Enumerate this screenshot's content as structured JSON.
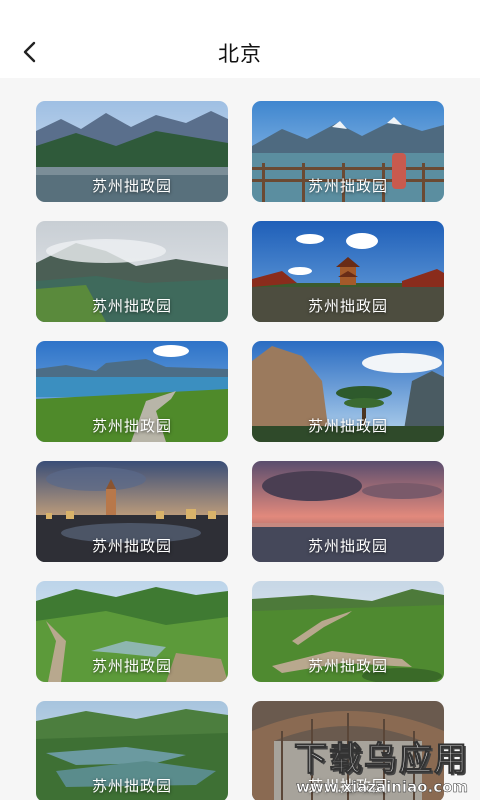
{
  "header": {
    "title": "北京"
  },
  "cards": [
    {
      "caption": "苏州拙政园",
      "scene": "mountain-lake"
    },
    {
      "caption": "苏州拙政园",
      "scene": "lake-railing"
    },
    {
      "caption": "苏州拙政园",
      "scene": "misty-lake"
    },
    {
      "caption": "苏州拙政园",
      "scene": "pagoda-sky"
    },
    {
      "caption": "苏州拙政园",
      "scene": "coast-road"
    },
    {
      "caption": "苏州拙政园",
      "scene": "rock-pine"
    },
    {
      "caption": "苏州拙政园",
      "scene": "city-tower"
    },
    {
      "caption": "苏州拙政园",
      "scene": "sunset-sea"
    },
    {
      "caption": "苏州拙政园",
      "scene": "green-valley"
    },
    {
      "caption": "苏州拙政园",
      "scene": "great-wall"
    },
    {
      "caption": "苏州拙政园",
      "scene": "reservoir"
    },
    {
      "caption": "苏州拙政园",
      "scene": "arch-structure"
    }
  ],
  "watermark": {
    "top": "下载乌应用",
    "bottom": "www.xiazainiao.com"
  }
}
